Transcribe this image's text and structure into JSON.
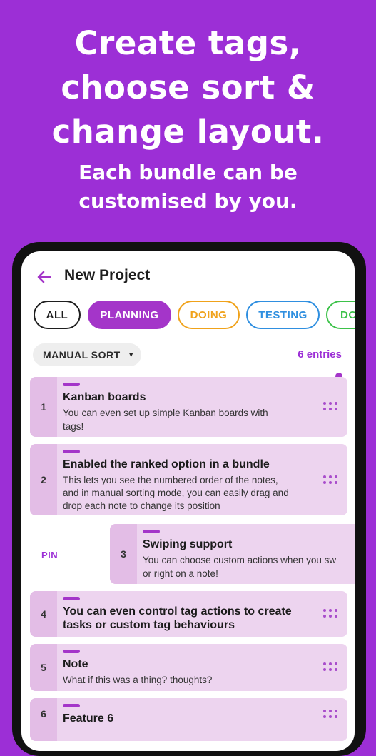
{
  "promo": {
    "headline_line1": "Create tags,",
    "headline_line2": "choose sort &",
    "headline_line3": "change layout.",
    "sub_line1": "Each bundle can be",
    "sub_line2": "customised by you."
  },
  "appbar": {
    "back_icon": "arrow-left-icon",
    "title": "New Project"
  },
  "colors": {
    "background": "#9c2fd6",
    "accent": "#a435c9",
    "card": "#edd4ef",
    "card_number": "#e3bde6",
    "doing": "#f0a21a",
    "testing": "#2f8fe0",
    "done": "#3dc24a"
  },
  "chips": [
    {
      "label": "ALL"
    },
    {
      "label": "PLANNING"
    },
    {
      "label": "DOING"
    },
    {
      "label": "TESTING"
    },
    {
      "label": "DO"
    }
  ],
  "sort": {
    "label": "MANUAL SORT",
    "caret_icon": "caret-down-icon",
    "entries": "6 entries"
  },
  "swipe": {
    "pin_label": "PIN"
  },
  "notes": [
    {
      "num": "1",
      "title": "Kanban boards",
      "body_line1": "You can even set up simple Kanban boards with",
      "body_line2": "tags!"
    },
    {
      "num": "2",
      "title": "Enabled the ranked option in a bundle",
      "body_line1": "This lets you see the numbered order of the notes,",
      "body_line2": "and in manual sorting mode, you can easily drag and",
      "body_line3": "drop each note to change its position"
    },
    {
      "num": "3",
      "title": "Swiping support",
      "body_line1": "You can choose custom actions when you sw",
      "body_line2": "or right on a note!"
    },
    {
      "num": "4",
      "title_line1": "You can even control tag actions to create",
      "title_line2": "tasks or custom tag behaviours"
    },
    {
      "num": "5",
      "title": "Note",
      "body_line1": "What if this was a thing? thoughts?"
    },
    {
      "num": "6",
      "title": "Feature 6"
    }
  ]
}
